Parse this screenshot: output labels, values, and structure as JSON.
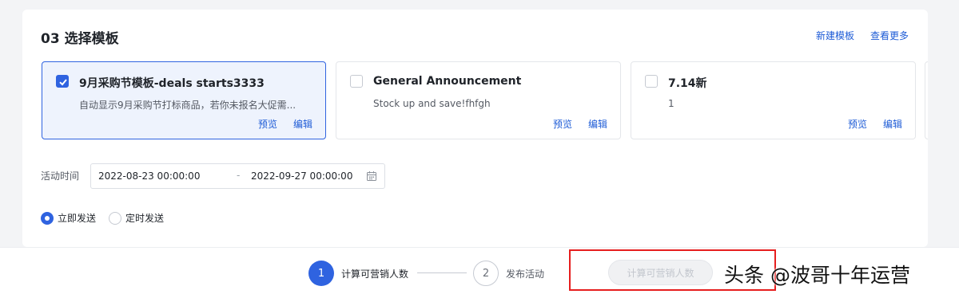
{
  "section": {
    "title": "03 选择模板",
    "new_template_link": "新建模板",
    "see_more_link": "查看更多"
  },
  "templates": [
    {
      "name": "9月采购节模板-deals starts3333",
      "description": "自动显示9月采购节打标商品，若你未报名大促需...",
      "selected": true,
      "preview": "预览",
      "edit": "编辑"
    },
    {
      "name": "General Announcement",
      "description": "Stock up and save!fhfgh",
      "selected": false,
      "preview": "预览",
      "edit": "编辑"
    },
    {
      "name": "7.14新",
      "description": "1",
      "selected": false,
      "preview": "预览",
      "edit": "编辑"
    }
  ],
  "activity_time": {
    "label": "活动时间",
    "start": "2022-08-23 00:00:00",
    "separator": "-",
    "end": "2022-09-27 00:00:00"
  },
  "send_mode": {
    "options": [
      {
        "label": "立即发送",
        "checked": true
      },
      {
        "label": "定时发送",
        "checked": false
      }
    ]
  },
  "steps": [
    {
      "number": "1",
      "label": "计算可营销人数",
      "active": true
    },
    {
      "number": "2",
      "label": "发布活动",
      "active": false
    }
  ],
  "footer": {
    "calc_button": "计算可营销人数",
    "watermark": "头条 @波哥十年运营"
  },
  "colors": {
    "accent": "#2f63e0",
    "highlight_border": "#e61e1e",
    "page_bg": "#f3f4f6"
  }
}
